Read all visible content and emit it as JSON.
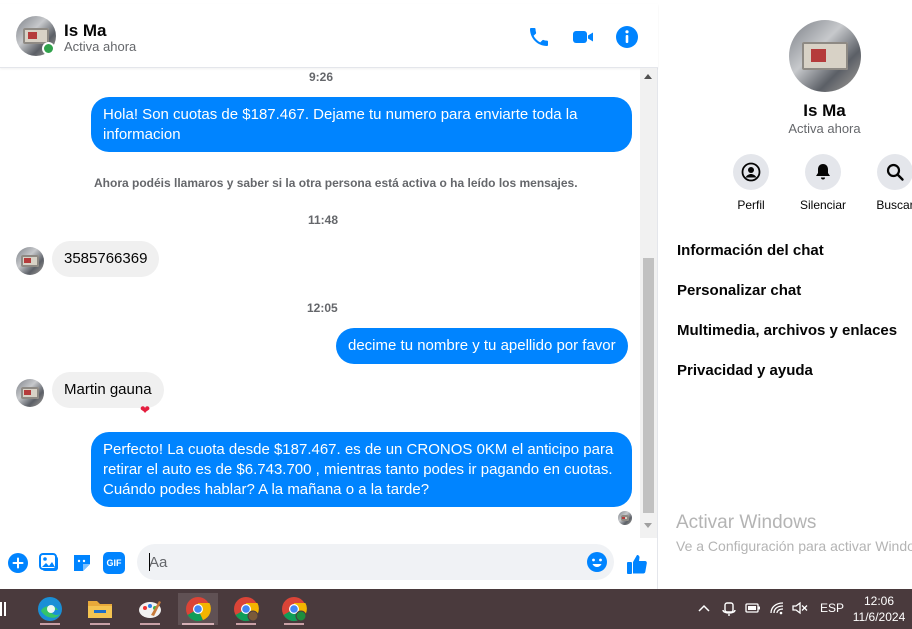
{
  "colors": {
    "accent": "#0084ff",
    "online": "#31a24c",
    "heart": "#e41e3f",
    "taskbar": "#4a3a3d"
  },
  "header": {
    "name": "Is Ma",
    "status": "Activa ahora",
    "icons": [
      "phone-icon",
      "video-camera-icon",
      "info-icon"
    ]
  },
  "messages": [
    {
      "type": "time",
      "text": "9:26"
    },
    {
      "type": "outgoing",
      "text": "Hola! Son cuotas de $187.467. Dejame tu numero para enviarte toda la informacion"
    },
    {
      "type": "system",
      "text": "Ahora podéis llamaros y saber si la otra persona está activa o ha leído los mensajes."
    },
    {
      "type": "time",
      "text": "11:48"
    },
    {
      "type": "incoming",
      "text": "3585766369"
    },
    {
      "type": "time",
      "text": "12:05"
    },
    {
      "type": "outgoing",
      "text": "decime tu nombre y tu apellido por favor"
    },
    {
      "type": "incoming",
      "text": "Martin gauna",
      "reaction": "❤"
    },
    {
      "type": "outgoing",
      "text": "Perfecto! La cuota desde $187.467. es de un CRONOS 0KM el anticipo para retirar el auto es de $6.743.700 , mientras tanto podes ir pagando en cuotas. Cuándo podes hablar? A la mañana o a la tarde?"
    }
  ],
  "composer": {
    "placeholder": "Aa",
    "gif_label": "GIF",
    "icons": [
      "plus-circle-icon",
      "photo-icon",
      "sticker-icon",
      "gif-icon",
      "emoji-icon",
      "thumbs-up-icon"
    ]
  },
  "info": {
    "name": "Is Ma",
    "status": "Activa ahora",
    "actions": [
      {
        "label": "Perfil",
        "icon": "profile-icon"
      },
      {
        "label": "Silenciar",
        "icon": "bell-icon"
      },
      {
        "label": "Buscar",
        "icon": "search-icon"
      }
    ],
    "menu": [
      "Información del chat",
      "Personalizar chat",
      "Multimedia, archivos y enlaces",
      "Privacidad y ayuda"
    ]
  },
  "watermark": {
    "line1": "Activar Windows",
    "line2": "Ve a Configuración para activar Windows."
  },
  "taskbar": {
    "apps": [
      "edge-icon",
      "file-explorer-icon",
      "paint-icon",
      "chrome-icon",
      "chrome-profile-icon",
      "chrome-profile-2-icon"
    ],
    "language": "ESP",
    "time": "12:06",
    "date": "11/6/2024"
  }
}
